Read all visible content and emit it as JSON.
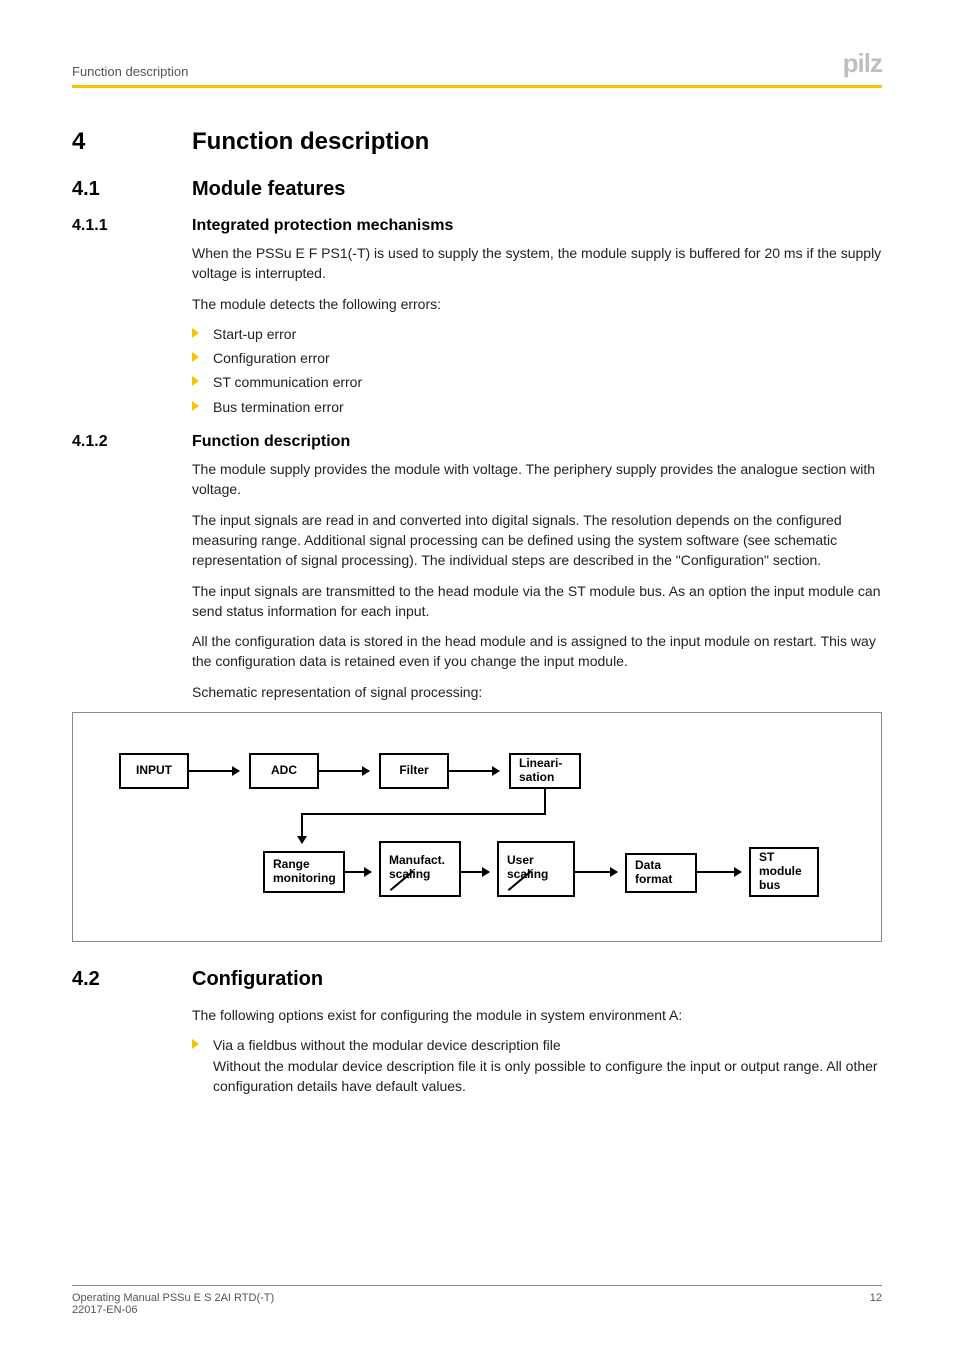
{
  "header": {
    "breadcrumb": "Function description",
    "logo_text": "pilz"
  },
  "s4": {
    "num": "4",
    "title": "Function description"
  },
  "s41": {
    "num": "4.1",
    "title": "Module features"
  },
  "s411": {
    "num": "4.1.1",
    "title": "Integrated protection mechanisms",
    "p1": "When the PSSu E F PS1(-T) is used to supply the system, the module supply is buffered for 20 ms if the supply voltage is interrupted.",
    "p2": "The module detects the following errors:",
    "bullets": [
      "Start-up error",
      "Configuration error",
      "ST communication error",
      "Bus termination error"
    ]
  },
  "s412": {
    "num": "4.1.2",
    "title": "Function description",
    "p1": "The module supply provides the module with voltage. The periphery supply provides the analogue section with voltage.",
    "p2": "The input signals are read in and converted into digital signals. The resolution depends on the configured measuring range. Additional signal processing can be defined using the system software (see schematic representation of signal processing). The individual steps are described in the \"Configuration\" section.",
    "p3": "The input signals are transmitted to the head module via the ST module bus. As an option the input module can send status information for each input.",
    "p4": "All the configuration data is stored in the head module and is assigned to the input module on restart. This way the configuration data is retained even if you change the input module.",
    "p5": "Schematic representation of signal processing:"
  },
  "diagram": {
    "input": "INPUT",
    "adc": "ADC",
    "filter": "Filter",
    "linear_l1": "Lineari-",
    "linear_l2": "sation",
    "range_l1": "Range",
    "range_l2": "monitoring",
    "manuf_l1": "Manufact.",
    "manuf_l2": "scaling",
    "user_l1": "User",
    "user_l2": "scaling",
    "data_l1": "Data",
    "data_l2": "format",
    "st_l1": "ST",
    "st_l2": "module",
    "st_l3": "bus"
  },
  "s42": {
    "num": "4.2",
    "title": "Configuration",
    "p1": "The following options exist for configuring the module in system environment A:",
    "b1_l1": "Via a fieldbus without the modular device description file",
    "b1_l2": "Without the modular device description file it is only possible to configure the input or output range. All other configuration details have default values."
  },
  "footer": {
    "l1": "Operating Manual PSSu E S 2AI RTD(-T)",
    "l2": "22017-EN-06",
    "page": "12"
  }
}
